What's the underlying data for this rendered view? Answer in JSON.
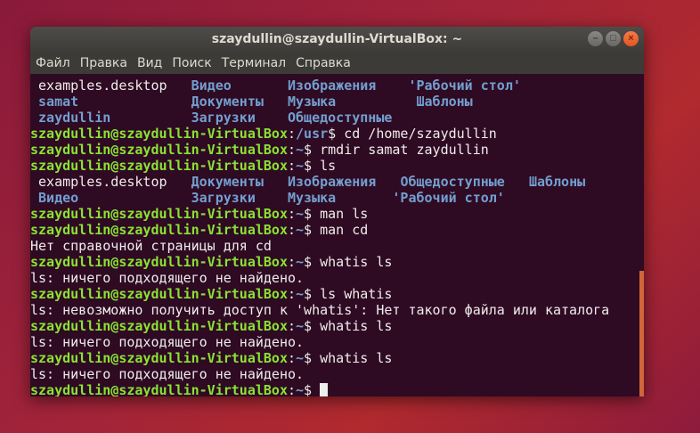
{
  "window": {
    "title": "szaydullin@szaydullin-VirtualBox: ~",
    "buttons": {
      "minimize": "–",
      "maximize": "□",
      "close": "×"
    }
  },
  "menu": [
    "Файл",
    "Правка",
    "Вид",
    "Поиск",
    "Терминал",
    "Справка"
  ],
  "terminal": {
    "lines": [
      [
        {
          "t": " examples.desktop   ",
          "c": "w"
        },
        {
          "t": "Видео",
          "c": "b"
        },
        {
          "t": "       ",
          "c": "w"
        },
        {
          "t": "Изображения",
          "c": "b"
        },
        {
          "t": "    ",
          "c": "w"
        },
        {
          "t": "'Рабочий стол'",
          "c": "b"
        }
      ],
      [
        {
          "t": " ",
          "c": "w"
        },
        {
          "t": "samat",
          "c": "b"
        },
        {
          "t": "              ",
          "c": "w"
        },
        {
          "t": "Документы",
          "c": "b"
        },
        {
          "t": "   ",
          "c": "w"
        },
        {
          "t": "Музыка",
          "c": "b"
        },
        {
          "t": "          ",
          "c": "w"
        },
        {
          "t": "Шаблоны",
          "c": "b"
        }
      ],
      [
        {
          "t": " ",
          "c": "w"
        },
        {
          "t": "zaydullin",
          "c": "b"
        },
        {
          "t": "          ",
          "c": "w"
        },
        {
          "t": "Загрузки",
          "c": "b"
        },
        {
          "t": "    ",
          "c": "w"
        },
        {
          "t": "Общедоступные",
          "c": "b"
        }
      ],
      [
        {
          "t": "szaydullin@szaydullin-VirtualBox",
          "c": "g"
        },
        {
          "t": ":",
          "c": "w"
        },
        {
          "t": "/usr",
          "c": "b"
        },
        {
          "t": "$ cd /home/szaydullin",
          "c": "w"
        }
      ],
      [
        {
          "t": "szaydullin@szaydullin-VirtualBox",
          "c": "g"
        },
        {
          "t": ":",
          "c": "w"
        },
        {
          "t": "~",
          "c": "b"
        },
        {
          "t": "$ rmdir samat zaydullin",
          "c": "w"
        }
      ],
      [
        {
          "t": "szaydullin@szaydullin-VirtualBox",
          "c": "g"
        },
        {
          "t": ":",
          "c": "w"
        },
        {
          "t": "~",
          "c": "b"
        },
        {
          "t": "$ ls",
          "c": "w"
        }
      ],
      [
        {
          "t": " examples.desktop   ",
          "c": "w"
        },
        {
          "t": "Документы",
          "c": "b"
        },
        {
          "t": "   ",
          "c": "w"
        },
        {
          "t": "Изображения",
          "c": "b"
        },
        {
          "t": "   ",
          "c": "w"
        },
        {
          "t": "Общедоступные",
          "c": "b"
        },
        {
          "t": "   ",
          "c": "w"
        },
        {
          "t": "Шаблоны",
          "c": "b"
        }
      ],
      [
        {
          "t": " ",
          "c": "w"
        },
        {
          "t": "Видео",
          "c": "b"
        },
        {
          "t": "              ",
          "c": "w"
        },
        {
          "t": "Загрузки",
          "c": "b"
        },
        {
          "t": "    ",
          "c": "w"
        },
        {
          "t": "Музыка",
          "c": "b"
        },
        {
          "t": "       ",
          "c": "w"
        },
        {
          "t": "'Рабочий стол'",
          "c": "b"
        }
      ],
      [
        {
          "t": "szaydullin@szaydullin-VirtualBox",
          "c": "g"
        },
        {
          "t": ":",
          "c": "w"
        },
        {
          "t": "~",
          "c": "b"
        },
        {
          "t": "$ man ls",
          "c": "w"
        }
      ],
      [
        {
          "t": "szaydullin@szaydullin-VirtualBox",
          "c": "g"
        },
        {
          "t": ":",
          "c": "w"
        },
        {
          "t": "~",
          "c": "b"
        },
        {
          "t": "$ man cd",
          "c": "w"
        }
      ],
      [
        {
          "t": "Нет справочной страницы для cd",
          "c": "w"
        }
      ],
      [
        {
          "t": "szaydullin@szaydullin-VirtualBox",
          "c": "g"
        },
        {
          "t": ":",
          "c": "w"
        },
        {
          "t": "~",
          "c": "b"
        },
        {
          "t": "$ whatis ls",
          "c": "w"
        }
      ],
      [
        {
          "t": "ls: ничего подходящего не найдено.",
          "c": "w"
        }
      ],
      [
        {
          "t": "szaydullin@szaydullin-VirtualBox",
          "c": "g"
        },
        {
          "t": ":",
          "c": "w"
        },
        {
          "t": "~",
          "c": "b"
        },
        {
          "t": "$ ls whatis",
          "c": "w"
        }
      ],
      [
        {
          "t": "ls: невозможно получить доступ к 'whatis': Нет такого файла или каталога",
          "c": "w"
        }
      ],
      [
        {
          "t": "szaydullin@szaydullin-VirtualBox",
          "c": "g"
        },
        {
          "t": ":",
          "c": "w"
        },
        {
          "t": "~",
          "c": "b"
        },
        {
          "t": "$ whatis ls",
          "c": "w"
        }
      ],
      [
        {
          "t": "ls: ничего подходящего не найдено.",
          "c": "w"
        }
      ],
      [
        {
          "t": "szaydullin@szaydullin-VirtualBox",
          "c": "g"
        },
        {
          "t": ":",
          "c": "w"
        },
        {
          "t": "~",
          "c": "b"
        },
        {
          "t": "$ whatis ls",
          "c": "w"
        }
      ],
      [
        {
          "t": "ls: ничего подходящего не найдено.",
          "c": "w"
        }
      ],
      [
        {
          "t": "szaydullin@szaydullin-VirtualBox",
          "c": "g"
        },
        {
          "t": ":",
          "c": "w"
        },
        {
          "t": "~",
          "c": "b"
        },
        {
          "t": "$ ",
          "c": "w"
        }
      ]
    ]
  },
  "colors": {
    "background": "#2f0a23",
    "prompt": "#8ae234",
    "directory": "#729fcf",
    "text": "#eeeeec",
    "scrollbar": "#d0663a"
  }
}
